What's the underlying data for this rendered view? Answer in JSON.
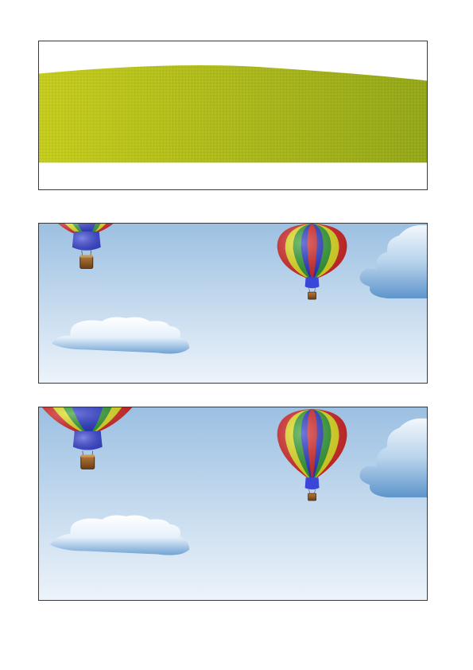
{
  "colors": {
    "panel_border": "#3a3a3a",
    "grass_light": "#c5cc1e",
    "grass_dark": "#8fa419",
    "sky_top": "#9cc0e2",
    "sky_bottom": "#ecf3fa",
    "cloud_light": "#ffffff",
    "cloud_shadow": "#6fa2d3",
    "balloon_stripes": [
      "#2230c8",
      "#e6e21a",
      "#2a9a2a",
      "#d82222",
      "#2230c8",
      "#e6e21a",
      "#2a9a2a",
      "#d82222"
    ],
    "basket": "#8a5424"
  },
  "panels": [
    {
      "name": "grass-panel",
      "icons": [
        "hill-illustration"
      ]
    },
    {
      "name": "sky-panel-small",
      "icons": [
        "hot-air-balloon-icon",
        "hot-air-balloon-icon",
        "cloud-icon",
        "cloud-icon"
      ]
    },
    {
      "name": "sky-panel-large",
      "icons": [
        "hot-air-balloon-icon",
        "hot-air-balloon-icon",
        "cloud-icon",
        "cloud-icon"
      ]
    }
  ]
}
